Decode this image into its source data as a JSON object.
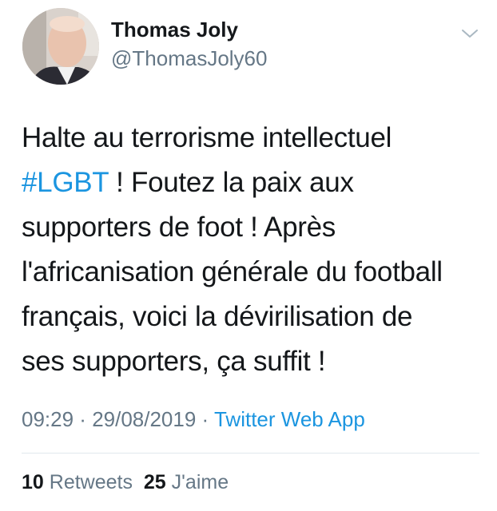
{
  "user": {
    "display_name": "Thomas Joly",
    "handle": "@ThomasJoly60",
    "avatar_icon": "profile-photo"
  },
  "header": {
    "menu_icon": "chevron-down-icon"
  },
  "tweet": {
    "lines": [
      {
        "text": "Halte au terrorisme intellectuel"
      },
      {
        "hashtag": "#LGBT",
        "text": " ! Foutez la paix aux"
      },
      {
        "text": "supporters de foot ! Après"
      },
      {
        "text": "l'africanisation générale du football"
      },
      {
        "text": "français, voici la dévirilisation de"
      },
      {
        "text": "ses supporters, ça suffit !"
      }
    ]
  },
  "meta": {
    "time": "09:29",
    "separator": " · ",
    "date": "29/08/2019",
    "source": "Twitter Web App"
  },
  "stats": {
    "retweets_count": "10",
    "retweets_label": "Retweets",
    "likes_count": "25",
    "likes_label": "J'aime"
  },
  "colors": {
    "link": "#1b95e0",
    "secondary": "#657786",
    "primary_text": "#14171a",
    "divider": "#e1e8ed"
  }
}
